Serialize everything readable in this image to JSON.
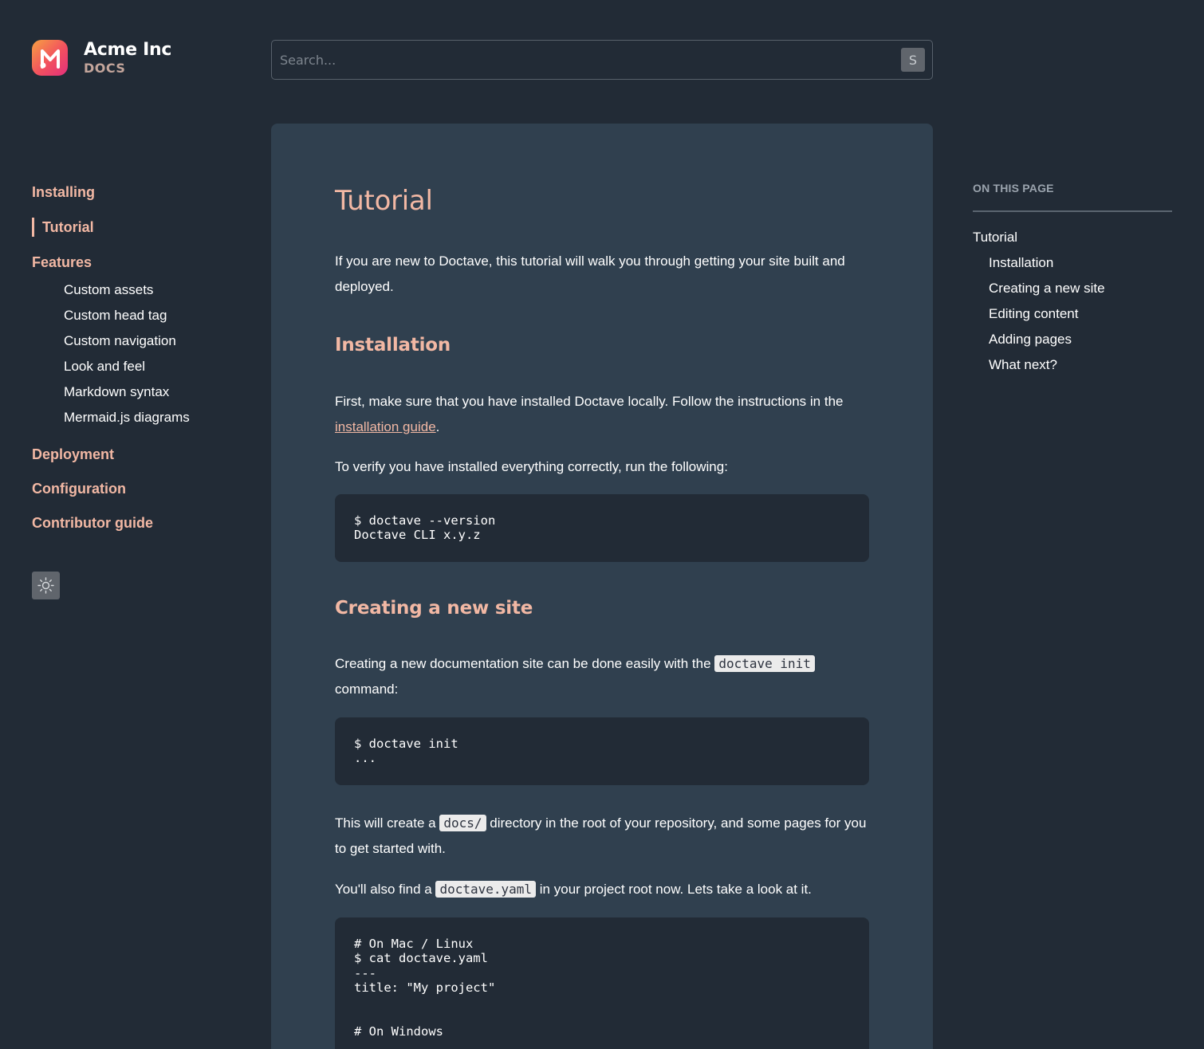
{
  "brand": {
    "name": "Acme Inc",
    "sub": "DOCS"
  },
  "search": {
    "placeholder": "Search...",
    "shortcut": "S"
  },
  "nav": {
    "installing": "Installing",
    "tutorial": "Tutorial",
    "features": "Features",
    "features_sub": [
      "Custom assets",
      "Custom head tag",
      "Custom navigation",
      "Look and feel",
      "Markdown syntax",
      "Mermaid.js diagrams"
    ],
    "deployment": "Deployment",
    "configuration": "Configuration",
    "contributor": "Contributor guide",
    "theme_icon": "sun-icon"
  },
  "article": {
    "title": "Tutorial",
    "intro": "If you are new to Doctave, this tutorial will walk you through getting your site built and deployed.",
    "installation": {
      "heading": "Installation",
      "p1_before": "First, make sure that you have installed Doctave locally. Follow the instructions in the",
      "p1_link": "installation guide",
      "p1_after": ".",
      "p2": "To verify you have installed everything correctly, run the following:",
      "code": "$ doctave --version\nDoctave CLI x.y.z"
    },
    "new_site": {
      "heading": "Creating a new site",
      "p1_before": "Creating a new documentation site can be done easily with the",
      "p1_code": "doctave init",
      "p1_after": "command:",
      "code1": "$ doctave init\n...",
      "p2_before": "This will create a",
      "p2_code": "docs/",
      "p2_after": "directory in the root of your repository, and some pages for you to get started with.",
      "p3_before": "You'll also find a",
      "p3_code": "doctave.yaml",
      "p3_after": "in your project root now. Lets take a look at it.",
      "code2": "# On Mac / Linux\n$ cat doctave.yaml\n---\ntitle: \"My project\"\n\n\n# On Windows"
    }
  },
  "toc": {
    "title": "ON THIS PAGE",
    "items": [
      "Tutorial",
      "Installation",
      "Creating a new site",
      "Editing content",
      "Adding pages",
      "What next?"
    ]
  },
  "colors": {
    "background": "#222b36",
    "panel": "#30404f",
    "accent": "#f2b8a4"
  }
}
